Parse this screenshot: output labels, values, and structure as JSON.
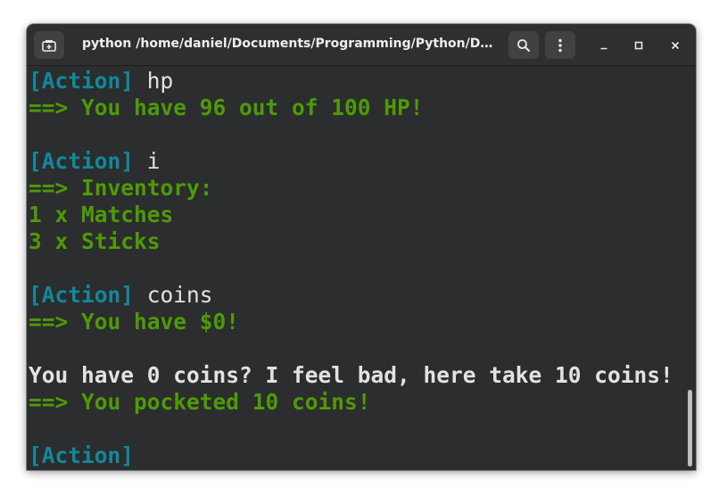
{
  "window": {
    "title": "python /home/daniel/Documents/Programming/Python/Dun..."
  },
  "icons": {
    "new_tab": "new-tab-icon",
    "search": "search-icon",
    "menu": "kebab-menu-icon",
    "minimize": "minimize-icon",
    "maximize": "maximize-icon",
    "close": "close-icon"
  },
  "colors": {
    "prompt": "#12889a",
    "output": "#4e9a06",
    "text": "#e2e2e2",
    "background": "#2b2d2e"
  },
  "terminal": {
    "lines": [
      {
        "prompt": "[Action]",
        "command": " hp"
      },
      {
        "output": "==> You have 96 out of 100 HP!"
      },
      {
        "output": "==> Inventory:"
      },
      {
        "output": "1 x Matches"
      },
      {
        "output": "3 x Sticks"
      },
      {
        "prompt": "[Action]",
        "command": " i"
      },
      {
        "prompt": "[Action]",
        "command": " coins"
      },
      {
        "output": "==> You have $0!"
      },
      {
        "message": "You have 0 coins? I feel bad, here take 10 coins!"
      },
      {
        "output": "==> You pocketed 10 coins!"
      },
      {
        "prompt": "[Action]"
      }
    ]
  }
}
